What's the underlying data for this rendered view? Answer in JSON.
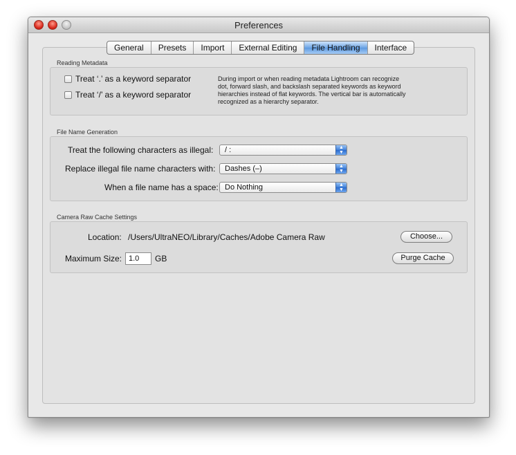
{
  "window": {
    "title": "Preferences"
  },
  "tabs": [
    {
      "label": "General",
      "active": false
    },
    {
      "label": "Presets",
      "active": false
    },
    {
      "label": "Import",
      "active": false
    },
    {
      "label": "External Editing",
      "active": false
    },
    {
      "label": "File Handling",
      "active": true
    },
    {
      "label": "Interface",
      "active": false
    }
  ],
  "reading_metadata": {
    "title": "Reading Metadata",
    "option_dot": {
      "label": "Treat ‘.’ as a keyword separator",
      "checked": false
    },
    "option_slash": {
      "label": "Treat ‘/’ as a keyword separator",
      "checked": false
    },
    "help_text_lines": [
      "During import or when reading metadata Lightroom can recognize",
      "dot, forward slash, and backslash separated keywords as keyword",
      "hierarchies instead of flat keywords. The vertical bar is automatically",
      "recognized as a hierarchy separator."
    ]
  },
  "file_name_generation": {
    "title": "File Name Generation",
    "illegal_chars": {
      "label": "Treat the following characters as illegal:",
      "value": "/ :"
    },
    "replace_with": {
      "label": "Replace illegal file name characters with:",
      "value": "Dashes (–)"
    },
    "space_handling": {
      "label": "When a file name has a space:",
      "value": "Do Nothing"
    }
  },
  "camera_raw_cache": {
    "title": "Camera Raw Cache Settings",
    "location_label": "Location:",
    "location_path": "/Users/UltraNEO/Library/Caches/Adobe Camera Raw",
    "choose_button": "Choose...",
    "max_size_label": "Maximum Size:",
    "max_size_value": "1.0",
    "max_size_unit": "GB",
    "purge_button": "Purge Cache"
  },
  "colors": {
    "active_tab": "#6fa6e5",
    "close_button": "#d8261a"
  }
}
